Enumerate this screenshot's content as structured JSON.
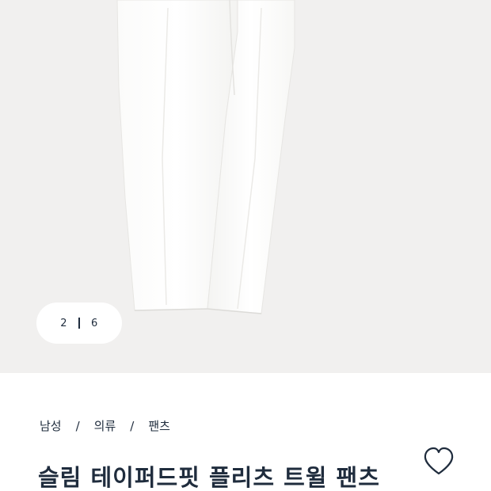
{
  "gallery": {
    "counter": {
      "current": "2",
      "total": "6"
    },
    "image_icon": "product-photo-white-pants"
  },
  "breadcrumb": {
    "items": [
      "남성",
      "의류",
      "팬츠"
    ],
    "separator": "/"
  },
  "product": {
    "title": "슬림 테이퍼드핏 플리츠 트윌 팬츠"
  },
  "wishlist": {
    "icon": "heart-outline-icon"
  },
  "colors": {
    "gallery_bg": "#f1f0ef",
    "text_navy": "#1f2c3d",
    "pants_white": "#ffffff"
  }
}
